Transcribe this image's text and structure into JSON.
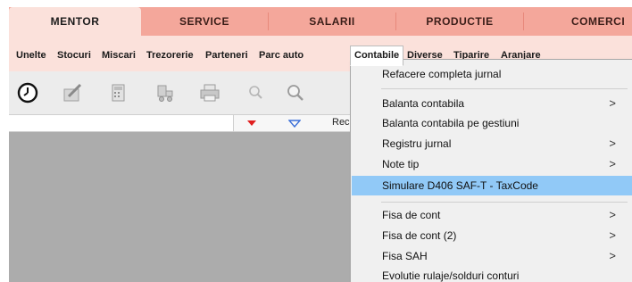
{
  "modules": {
    "tabs": [
      {
        "label": "MENTOR"
      },
      {
        "label": "SERVICE"
      },
      {
        "label": "SALARII"
      },
      {
        "label": "PRODUCTIE"
      },
      {
        "label": "COMERCI"
      }
    ]
  },
  "menubar": {
    "items": [
      {
        "label": "Unelte"
      },
      {
        "label": "Stocuri"
      },
      {
        "label": "Miscari"
      },
      {
        "label": "Trezorerie"
      },
      {
        "label": "Parteneri"
      },
      {
        "label": "Parc auto"
      },
      {
        "label": "Contabile"
      },
      {
        "label": "Diverse"
      },
      {
        "label": "Tiparire"
      },
      {
        "label": "Aranjare"
      }
    ]
  },
  "toolbar": {
    "icons": [
      "clock-icon",
      "edit-icon",
      "calculator-icon",
      "delivery-icon",
      "printer-icon",
      "search-icon",
      "zoom-icon"
    ]
  },
  "filterbar": {
    "rec_label": "Rec"
  },
  "dropdown": {
    "items": [
      {
        "label": "Refacere completa jurnal",
        "submenu": ""
      },
      {
        "label": "Balanta contabila",
        "submenu": ">"
      },
      {
        "label": "Balanta contabila pe gestiuni",
        "submenu": ""
      },
      {
        "label": "Registru jurnal",
        "submenu": ">"
      },
      {
        "label": "Note tip",
        "submenu": ">"
      },
      {
        "label": "Simulare D406 SAF-T - TaxCode",
        "submenu": ""
      },
      {
        "label": "Fisa de cont",
        "submenu": ">"
      },
      {
        "label": "Fisa de cont (2)",
        "submenu": ">"
      },
      {
        "label": "Fisa SAH",
        "submenu": ">"
      },
      {
        "label": "Evolutie rulaje/solduri conturi",
        "submenu": ""
      }
    ]
  },
  "colors": {
    "tab_bar": "#f4a79b",
    "tab_active": "#fbe1db",
    "menubar": "#fbe1db",
    "highlight": "#91c9f7",
    "workarea": "#acacac",
    "arrow_red": "#e02020",
    "arrow_blue": "#3a6fd8"
  }
}
